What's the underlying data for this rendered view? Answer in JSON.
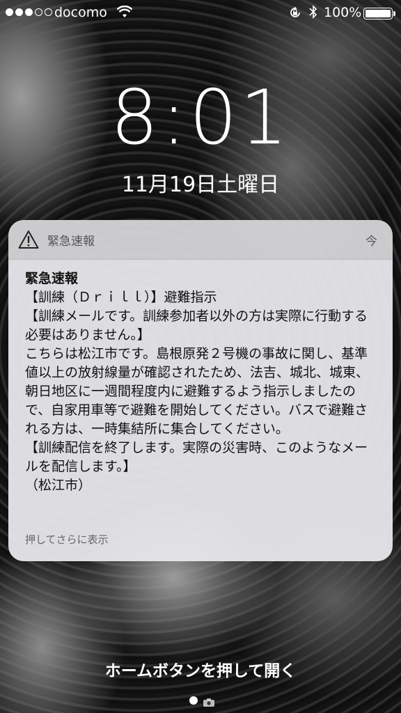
{
  "status_bar": {
    "signal": {
      "filled": 3,
      "empty": 2
    },
    "carrier": "docomo",
    "battery_percent": "100%"
  },
  "lock_screen": {
    "time": "8:01",
    "date": "11月19日土曜日",
    "unlock_hint": "ホームボタンを押して開く"
  },
  "notification": {
    "app_name": "緊急速報",
    "timestamp": "今",
    "title": "緊急速報",
    "body": "【訓練（Ｄｒｉｌｌ）】避難指示\n【訓練メールです。訓練参加者以外の方は実際に行動する必要はありません。】\nこちらは松江市です。島根原発２号機の事故に関し、基準値以上の放射線量が確認されたため、法吉、城北、城東、朝日地区に一週間程度内に避難するよう指示しましたので、自家用車等で避難を開始してください。バスで避難される方は、一時集結所に集合してください。\n【訓練配信を終了します。実際の災害時、このようなメールを配信します。】\n（松江市）",
    "more_label": "押してさらに表示",
    "icon": "warning-triangle-icon"
  },
  "icons": {
    "wifi": "wifi-icon",
    "rotation_lock": "rotation-lock-icon",
    "bluetooth": "bluetooth-icon",
    "battery": "battery-icon",
    "camera": "camera-icon"
  }
}
